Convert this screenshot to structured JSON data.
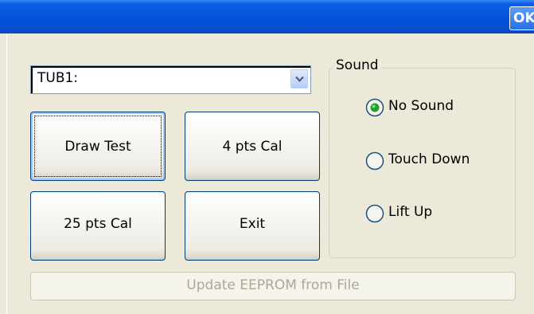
{
  "titlebar": {
    "ok_label": "OK"
  },
  "device_select": {
    "value": "TUB1:"
  },
  "buttons": {
    "draw_test": "Draw Test",
    "four_pts_cal": "4 pts Cal",
    "twenty_five_pts_cal": "25 pts Cal",
    "exit": "Exit",
    "update_eeprom": "Update EEPROM from File"
  },
  "sound_group": {
    "title": "Sound",
    "options": [
      {
        "label": "No Sound",
        "selected": true
      },
      {
        "label": "Touch Down",
        "selected": false
      },
      {
        "label": "Lift Up",
        "selected": false
      }
    ]
  },
  "colors": {
    "titlebar_blue": "#0350d8",
    "window_bg": "#ece9d8",
    "radio_selected_green": "#21a121"
  }
}
